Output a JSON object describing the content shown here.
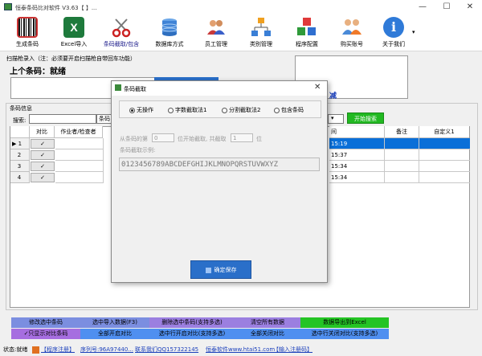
{
  "window": {
    "title": "恒泰条码比对软件 V3.63【 】..."
  },
  "toolbar": {
    "items": [
      {
        "label": "生成条码",
        "icon": "barcode-icon"
      },
      {
        "label": "Excel导入",
        "icon": "excel-icon"
      },
      {
        "label": "条码截取/包含",
        "icon": "scissors-icon"
      },
      {
        "label": "数据库方式",
        "icon": "database-icon"
      },
      {
        "label": "员工管理",
        "icon": "employees-icon"
      },
      {
        "label": "类别管理",
        "icon": "category-tree-icon"
      },
      {
        "label": "程序配置",
        "icon": "cubes-icon"
      },
      {
        "label": "购买账号",
        "icon": "purchase-icon"
      },
      {
        "label": "关于我们",
        "icon": "info-icon"
      }
    ]
  },
  "scan": {
    "label": "扫描枪录入（注：必须要开启扫描枪自带回车功能）",
    "last_code": "上个条码：就绪",
    "info_text": "减"
  },
  "grid_section": {
    "label": "条码信息",
    "search_label": "搜索:",
    "search_combo": "条码",
    "search_button": "开始搜索"
  },
  "grid": {
    "headers": {
      "compare": "对比",
      "operator": "作业者/检查者",
      "time": "间",
      "remark": "备注",
      "custom": "自定义1"
    },
    "rows": [
      {
        "num": "1",
        "check": "✓",
        "time": "15:19",
        "selected": true
      },
      {
        "num": "2",
        "check": "✓",
        "time": "15:37",
        "selected": false
      },
      {
        "num": "3",
        "check": "✓",
        "time": "15:34",
        "selected": false
      },
      {
        "num": "4",
        "check": "✓",
        "time": "15:34",
        "selected": false
      }
    ]
  },
  "buttons": {
    "row1": [
      "修改选中条码",
      "选中导入数据(F3)",
      "删除选中条码(支持多选)",
      "清空所有数据",
      "数据导出到Excel"
    ],
    "row2": [
      "✓只显示对比条码",
      "全部开启对比",
      "选中行开启对比(支持多选)",
      "全部关闭对比",
      "选中行关闭对比(支持多选)"
    ]
  },
  "statusbar": {
    "status": "状态:就绪",
    "register": "【程序注册】",
    "serial": "序列号:96A97440...",
    "contact": "联系我们QQ157322145",
    "website": "恒泰软件www.htai51.com",
    "enter_code": "【输入注册码】"
  },
  "dialog": {
    "title": "条码截取",
    "options": [
      {
        "label": "无操作",
        "checked": true
      },
      {
        "label": "字数截取法1",
        "checked": false
      },
      {
        "label": "分割截取法2",
        "checked": false
      },
      {
        "label": "包含条码",
        "checked": false
      }
    ],
    "from_label": "从条码的第",
    "from_value": "0",
    "start_label": "位开始截取, 共截取",
    "count_value": "1",
    "unit_label": "位",
    "example_label": "条码截取示例:",
    "example_value": "0123456789ABCDEFGHIJKLMNOPQRSTUVWXYZ",
    "save_button": "确定保存"
  },
  "colors": {
    "accent": "#2a6fc9",
    "selected_row": "#0a6fd8",
    "search_button": "#22b922",
    "link": "#1a3fbb"
  }
}
